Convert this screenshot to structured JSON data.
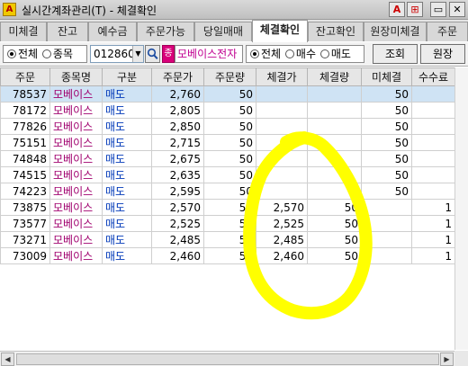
{
  "window": {
    "icon_text": "A",
    "title": "실시간계좌관리(T) - 체결확인",
    "controls": [
      "A",
      "⊞",
      "▭",
      "✕"
    ]
  },
  "tabs": [
    {
      "label": "미체결",
      "active": false
    },
    {
      "label": "잔고",
      "active": false
    },
    {
      "label": "예수금",
      "active": false
    },
    {
      "label": "주문가능",
      "active": false
    },
    {
      "label": "당일매매",
      "active": false
    },
    {
      "label": "체결확인",
      "active": true
    },
    {
      "label": "잔고확인",
      "active": false
    },
    {
      "label": "원장미체결",
      "active": false
    },
    {
      "label": "주문",
      "active": false
    }
  ],
  "filter1": {
    "options": [
      "전체",
      "종목"
    ],
    "selected": "전체"
  },
  "code_input": {
    "value": "012860"
  },
  "stock": {
    "tag": "종",
    "name": "모베이스전자"
  },
  "filter2": {
    "options": [
      "전체",
      "매수",
      "매도"
    ],
    "selected": "전체"
  },
  "buttons": {
    "query": "조회",
    "ledger": "원장"
  },
  "table": {
    "headers": [
      "주문",
      "종목명",
      "구분",
      "주문가",
      "주문량",
      "체결가",
      "체결량",
      "미체결",
      "수수료"
    ],
    "rows": [
      [
        "78537",
        "모베이스",
        "매도",
        "2,760",
        "50",
        "",
        "",
        "50",
        ""
      ],
      [
        "78172",
        "모베이스",
        "매도",
        "2,805",
        "50",
        "",
        "",
        "50",
        ""
      ],
      [
        "77826",
        "모베이스",
        "매도",
        "2,850",
        "50",
        "",
        "",
        "50",
        ""
      ],
      [
        "75151",
        "모베이스",
        "매도",
        "2,715",
        "50",
        "",
        "",
        "50",
        ""
      ],
      [
        "74848",
        "모베이스",
        "매도",
        "2,675",
        "50",
        "",
        "",
        "50",
        ""
      ],
      [
        "74515",
        "모베이스",
        "매도",
        "2,635",
        "50",
        "",
        "",
        "50",
        ""
      ],
      [
        "74223",
        "모베이스",
        "매도",
        "2,595",
        "50",
        "",
        "",
        "50",
        ""
      ],
      [
        "73875",
        "모베이스",
        "매도",
        "2,570",
        "50",
        "2,570",
        "50",
        "",
        "1"
      ],
      [
        "73577",
        "모베이스",
        "매도",
        "2,525",
        "50",
        "2,525",
        "50",
        "",
        "1"
      ],
      [
        "73271",
        "모베이스",
        "매도",
        "2,485",
        "50",
        "2,485",
        "50",
        "",
        "1"
      ],
      [
        "73009",
        "모베이스",
        "매도",
        "2,460",
        "50",
        "2,460",
        "50",
        "",
        "1"
      ]
    ],
    "selected_row": 0
  },
  "colors": {
    "highlight_marker": "#ffff00",
    "stock_name": "#a0006e",
    "side_label": "#0038b8",
    "selected_row": "#cfe3f4"
  },
  "icons": {
    "search": "magnifier",
    "dropdown": "triangle-down",
    "scroll_left": "triangle-left",
    "scroll_right": "triangle-right"
  }
}
